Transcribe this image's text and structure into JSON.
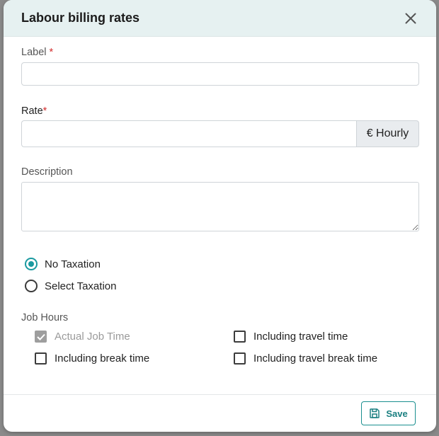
{
  "dialog": {
    "title": "Labour billing rates"
  },
  "form": {
    "label_field": {
      "label": "Label",
      "required_mark": "*",
      "value": ""
    },
    "rate_field": {
      "label": "Rate",
      "required_mark": "*",
      "value": "",
      "addon": "€ Hourly"
    },
    "description_field": {
      "label": "Description",
      "value": ""
    },
    "taxation": {
      "options": [
        {
          "label": "No Taxation",
          "checked": true
        },
        {
          "label": "Select Taxation",
          "checked": false
        }
      ]
    },
    "job_hours": {
      "heading": "Job Hours",
      "options": [
        {
          "label": "Actual Job Time",
          "checked": true,
          "disabled": true
        },
        {
          "label": "Including travel time",
          "checked": false,
          "disabled": false
        },
        {
          "label": "Including break time",
          "checked": false,
          "disabled": false
        },
        {
          "label": "Including travel break time",
          "checked": false,
          "disabled": false
        }
      ]
    }
  },
  "footer": {
    "save_label": "Save"
  },
  "colors": {
    "accent": "#1a9aa0",
    "header_bg": "#e6f1f1",
    "required": "#d32f2f"
  }
}
